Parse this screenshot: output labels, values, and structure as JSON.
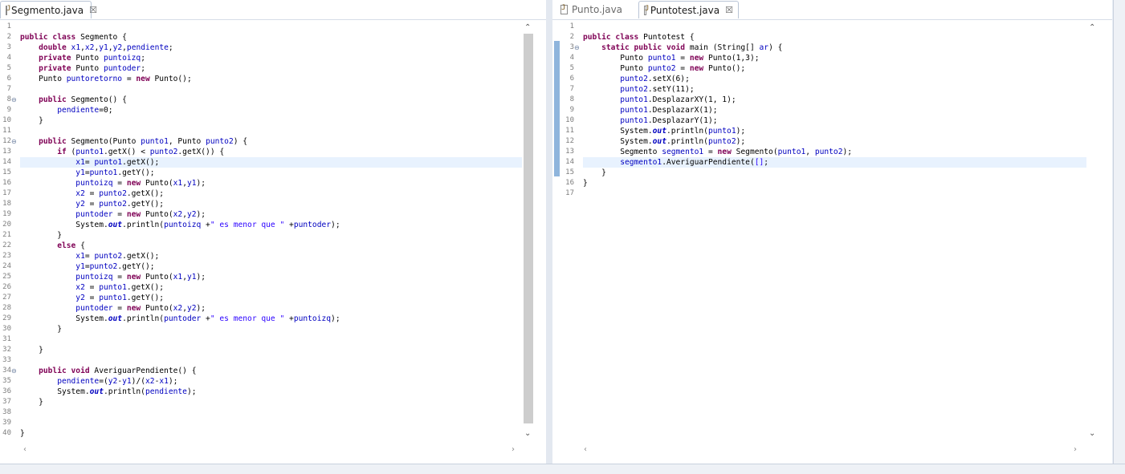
{
  "left_editor": {
    "tabs": [
      {
        "label": "Segmento.java",
        "active": true,
        "closable": true
      }
    ],
    "lines": [
      [],
      [
        [
          "public class ",
          "kw"
        ],
        [
          "Segmento {",
          ""
        ]
      ],
      [
        [
          "    double ",
          "kw"
        ],
        [
          "x1",
          "fd"
        ],
        [
          ",",
          ""
        ],
        [
          "x2",
          "fd"
        ],
        [
          ",",
          ""
        ],
        [
          "y1",
          "fd"
        ],
        [
          ",",
          ""
        ],
        [
          "y2",
          "fd"
        ],
        [
          ",",
          ""
        ],
        [
          "pendiente",
          "fd"
        ],
        [
          ";",
          ""
        ]
      ],
      [
        [
          "    private ",
          "kw"
        ],
        [
          "Punto ",
          ""
        ],
        [
          "puntoizq",
          "fd"
        ],
        [
          ";",
          ""
        ]
      ],
      [
        [
          "    private ",
          "kw"
        ],
        [
          "Punto ",
          ""
        ],
        [
          "puntoder",
          "fd"
        ],
        [
          ";",
          ""
        ]
      ],
      [
        [
          "    Punto ",
          ""
        ],
        [
          "puntoretorno",
          "fd"
        ],
        [
          " = ",
          ""
        ],
        [
          "new ",
          "kw"
        ],
        [
          "Punto();",
          ""
        ]
      ],
      [],
      [
        [
          "    public ",
          "kw"
        ],
        [
          "Segmento() {",
          ""
        ]
      ],
      [
        [
          "        pendiente",
          "fd"
        ],
        [
          "=0;",
          ""
        ]
      ],
      [
        [
          "    }",
          ""
        ]
      ],
      [],
      [
        [
          "    public ",
          "kw"
        ],
        [
          "Segmento(Punto ",
          ""
        ],
        [
          "punto1",
          "fd"
        ],
        [
          ", Punto ",
          ""
        ],
        [
          "punto2",
          "fd"
        ],
        [
          ") {",
          ""
        ]
      ],
      [
        [
          "        if ",
          "kw"
        ],
        [
          "(",
          ""
        ],
        [
          "punto1",
          "fd"
        ],
        [
          ".getX() < ",
          ""
        ],
        [
          "punto2",
          "fd"
        ],
        [
          ".getX()) {",
          ""
        ]
      ],
      [
        [
          "            x1",
          "fd"
        ],
        [
          "= ",
          ""
        ],
        [
          "punto1",
          "fd"
        ],
        [
          ".getX();",
          ""
        ]
      ],
      [
        [
          "            y1",
          "fd"
        ],
        [
          "=",
          ""
        ],
        [
          "punto1",
          "fd"
        ],
        [
          ".getY();",
          ""
        ]
      ],
      [
        [
          "            puntoizq",
          "fd"
        ],
        [
          " = ",
          ""
        ],
        [
          "new ",
          "kw"
        ],
        [
          "Punto(",
          ""
        ],
        [
          "x1",
          "fd"
        ],
        [
          ",",
          ""
        ],
        [
          "y1",
          "fd"
        ],
        [
          ");",
          ""
        ]
      ],
      [
        [
          "            x2",
          "fd"
        ],
        [
          " = ",
          ""
        ],
        [
          "punto2",
          "fd"
        ],
        [
          ".getX();",
          ""
        ]
      ],
      [
        [
          "            y2",
          "fd"
        ],
        [
          " = ",
          ""
        ],
        [
          "punto2",
          "fd"
        ],
        [
          ".getY();",
          ""
        ]
      ],
      [
        [
          "            puntoder",
          "fd"
        ],
        [
          " = ",
          ""
        ],
        [
          "new ",
          "kw"
        ],
        [
          "Punto(",
          ""
        ],
        [
          "x2",
          "fd"
        ],
        [
          ",",
          ""
        ],
        [
          "y2",
          "fd"
        ],
        [
          ");",
          ""
        ]
      ],
      [
        [
          "            System.",
          ""
        ],
        [
          "out",
          "it"
        ],
        [
          ".println(",
          ""
        ],
        [
          "puntoizq",
          "fd"
        ],
        [
          " +",
          ""
        ],
        [
          "\" es menor que \"",
          "st"
        ],
        [
          " +",
          ""
        ],
        [
          "puntoder",
          "fd"
        ],
        [
          ");",
          ""
        ]
      ],
      [
        [
          "        }",
          ""
        ]
      ],
      [
        [
          "        else ",
          "kw"
        ],
        [
          "{",
          ""
        ]
      ],
      [
        [
          "            x1",
          "fd"
        ],
        [
          "= ",
          ""
        ],
        [
          "punto2",
          "fd"
        ],
        [
          ".getX();",
          ""
        ]
      ],
      [
        [
          "            y1",
          "fd"
        ],
        [
          "=",
          ""
        ],
        [
          "punto2",
          "fd"
        ],
        [
          ".getY();",
          ""
        ]
      ],
      [
        [
          "            puntoizq",
          "fd"
        ],
        [
          " = ",
          ""
        ],
        [
          "new ",
          "kw"
        ],
        [
          "Punto(",
          ""
        ],
        [
          "x1",
          "fd"
        ],
        [
          ",",
          ""
        ],
        [
          "y1",
          "fd"
        ],
        [
          ");",
          ""
        ]
      ],
      [
        [
          "            x2",
          "fd"
        ],
        [
          " = ",
          ""
        ],
        [
          "punto1",
          "fd"
        ],
        [
          ".getX();",
          ""
        ]
      ],
      [
        [
          "            y2",
          "fd"
        ],
        [
          " = ",
          ""
        ],
        [
          "punto1",
          "fd"
        ],
        [
          ".getY();",
          ""
        ]
      ],
      [
        [
          "            puntoder",
          "fd"
        ],
        [
          " = ",
          ""
        ],
        [
          "new ",
          "kw"
        ],
        [
          "Punto(",
          ""
        ],
        [
          "x2",
          "fd"
        ],
        [
          ",",
          ""
        ],
        [
          "y2",
          "fd"
        ],
        [
          ");",
          ""
        ]
      ],
      [
        [
          "            System.",
          ""
        ],
        [
          "out",
          "it"
        ],
        [
          ".println(",
          ""
        ],
        [
          "puntoder",
          "fd"
        ],
        [
          " +",
          ""
        ],
        [
          "\" es menor que \"",
          "st"
        ],
        [
          " +",
          ""
        ],
        [
          "puntoizq",
          "fd"
        ],
        [
          ");",
          ""
        ]
      ],
      [
        [
          "        }",
          ""
        ]
      ],
      [],
      [
        [
          "    }",
          ""
        ]
      ],
      [],
      [
        [
          "    public void ",
          "kw"
        ],
        [
          "AveriguarPendiente() {",
          ""
        ]
      ],
      [
        [
          "        pendiente",
          "fd"
        ],
        [
          "=(",
          ""
        ],
        [
          "y2",
          "fd"
        ],
        [
          "-",
          ""
        ],
        [
          "y1",
          "fd"
        ],
        [
          ")/(",
          ""
        ],
        [
          "x2",
          "fd"
        ],
        [
          "-",
          ""
        ],
        [
          "x1",
          "fd"
        ],
        [
          ");",
          ""
        ]
      ],
      [
        [
          "        System.",
          ""
        ],
        [
          "out",
          "it"
        ],
        [
          ".println(",
          ""
        ],
        [
          "pendiente",
          "fd"
        ],
        [
          ");",
          ""
        ]
      ],
      [
        [
          "    }",
          ""
        ]
      ],
      [],
      [],
      [
        [
          "}",
          ""
        ]
      ]
    ],
    "folds": [
      8,
      12,
      34
    ],
    "highlight_line": 14
  },
  "right_editor": {
    "tabs": [
      {
        "label": "Punto.java",
        "active": false,
        "closable": false
      },
      {
        "label": "Puntotest.java",
        "active": true,
        "closable": true
      }
    ],
    "lines": [
      [],
      [
        [
          "public class ",
          "kw"
        ],
        [
          "Puntotest {",
          ""
        ]
      ],
      [
        [
          "    static public void ",
          "kw"
        ],
        [
          "main (String[] ",
          ""
        ],
        [
          "ar",
          "fd"
        ],
        [
          ") {",
          ""
        ]
      ],
      [
        [
          "        Punto ",
          ""
        ],
        [
          "punto1",
          "fd"
        ],
        [
          " = ",
          ""
        ],
        [
          "new ",
          "kw"
        ],
        [
          "Punto(1,3);",
          ""
        ]
      ],
      [
        [
          "        Punto ",
          ""
        ],
        [
          "punto2",
          "fd"
        ],
        [
          " = ",
          ""
        ],
        [
          "new ",
          "kw"
        ],
        [
          "Punto();",
          ""
        ]
      ],
      [
        [
          "        punto2",
          "fd"
        ],
        [
          ".setX(6);",
          ""
        ]
      ],
      [
        [
          "        punto2",
          "fd"
        ],
        [
          ".setY(11);",
          ""
        ]
      ],
      [
        [
          "        punto1",
          "fd"
        ],
        [
          ".DesplazarXY(1, 1);",
          ""
        ]
      ],
      [
        [
          "        punto1",
          "fd"
        ],
        [
          ".DesplazarX(1);",
          ""
        ]
      ],
      [
        [
          "        punto1",
          "fd"
        ],
        [
          ".DesplazarY(1);",
          ""
        ]
      ],
      [
        [
          "        System.",
          ""
        ],
        [
          "out",
          "it"
        ],
        [
          ".println(",
          ""
        ],
        [
          "punto1",
          "fd"
        ],
        [
          ");",
          ""
        ]
      ],
      [
        [
          "        System.",
          ""
        ],
        [
          "out",
          "it"
        ],
        [
          ".println(",
          ""
        ],
        [
          "punto2",
          "fd"
        ],
        [
          ");",
          ""
        ]
      ],
      [
        [
          "        Segmento ",
          ""
        ],
        [
          "segmento1",
          "fd"
        ],
        [
          " = ",
          ""
        ],
        [
          "new ",
          "kw"
        ],
        [
          "Segmento(",
          ""
        ],
        [
          "punto1",
          "fd"
        ],
        [
          ", ",
          ""
        ],
        [
          "punto2",
          "fd"
        ],
        [
          ");",
          ""
        ]
      ],
      [
        [
          "        segmento1",
          "fd"
        ],
        [
          ".AveriguarPendiente(",
          ""
        ],
        [
          "[]",
          "st"
        ],
        [
          ";",
          ""
        ]
      ],
      [
        [
          "    }",
          ""
        ]
      ],
      [
        [
          "}",
          ""
        ]
      ],
      []
    ],
    "folds": [
      3
    ],
    "highlight_line": 14
  },
  "colors": {
    "keyword": "#7f0055",
    "field": "#0000c0",
    "string": "#2a00ff",
    "current_line": "#e8f2fe"
  }
}
